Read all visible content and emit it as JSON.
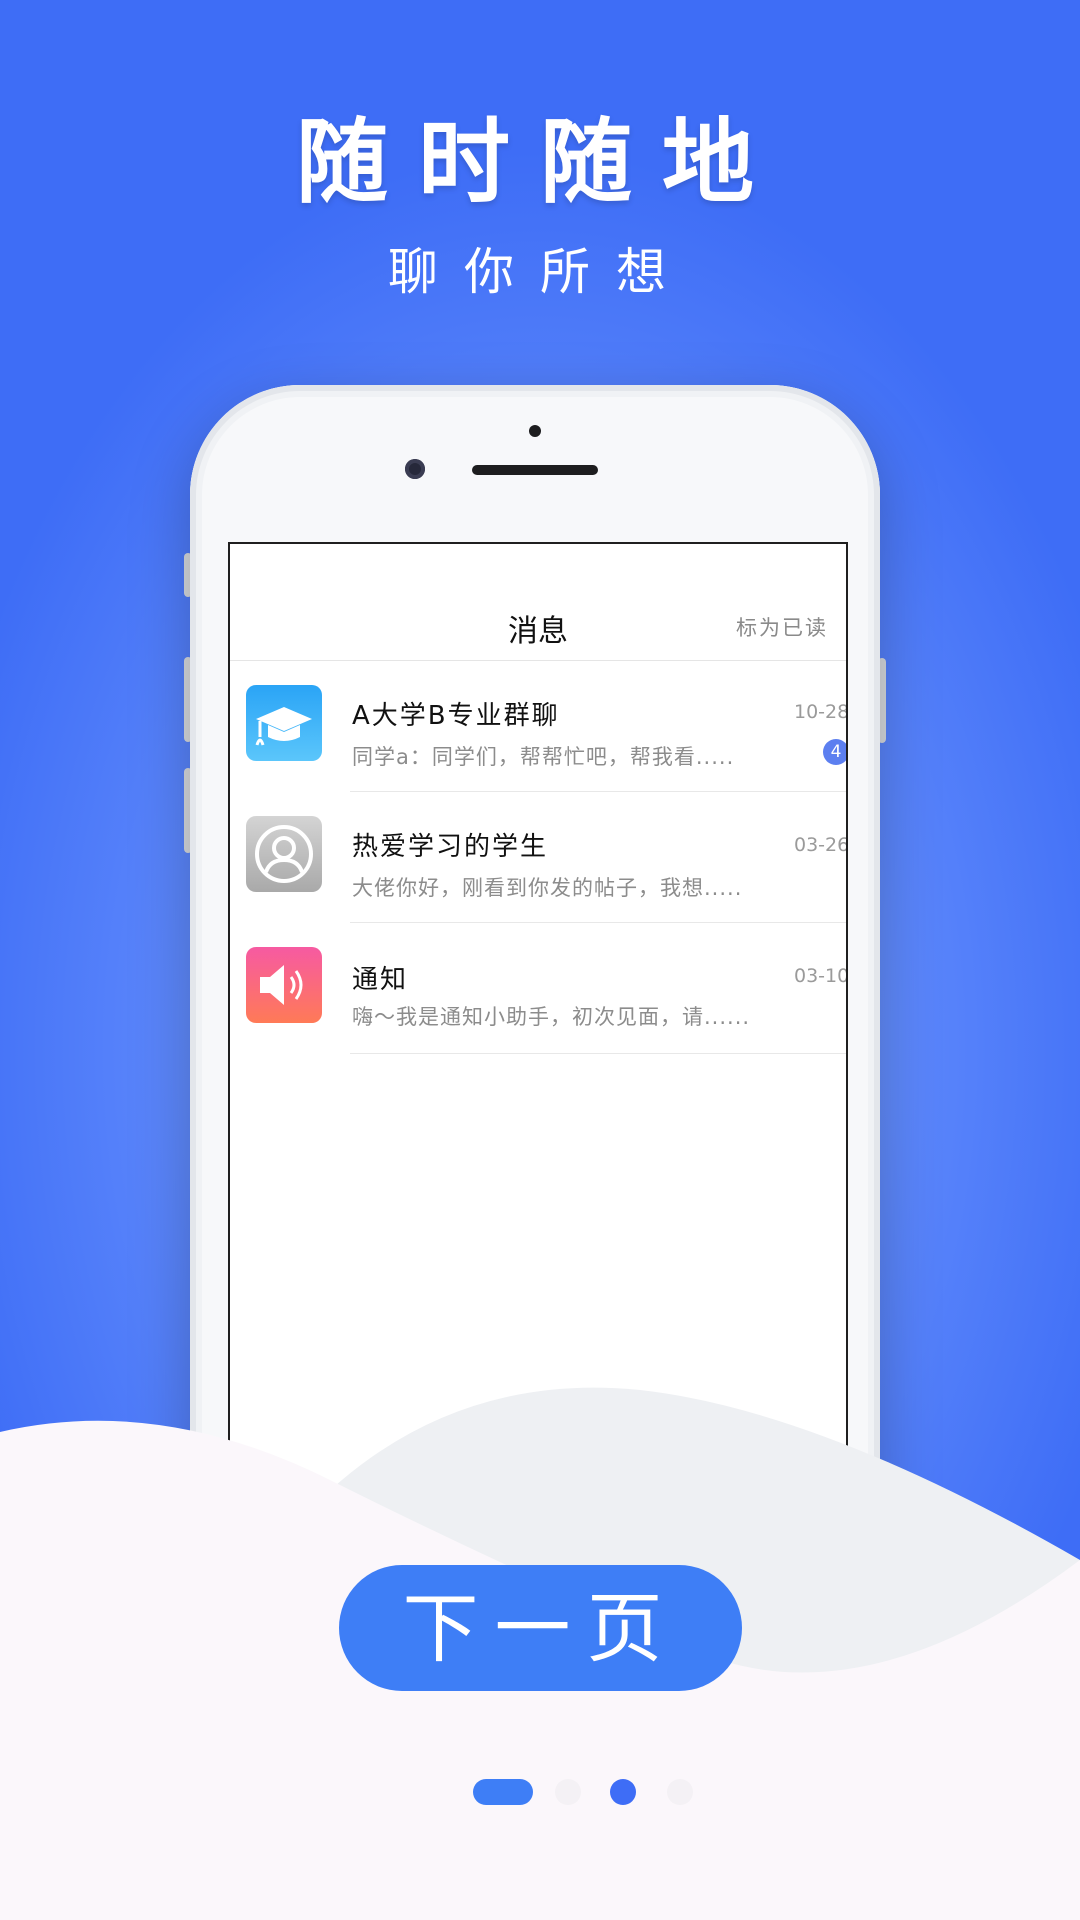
{
  "headline": "随时随地",
  "subline": "聊你所想",
  "app": {
    "title": "消息",
    "mark_read": "标为已读",
    "conversations": [
      {
        "name": "A大学B专业群聊",
        "preview": "同学a：同学们，帮帮忙吧，帮我看.....",
        "date": "10-28",
        "badge": "4",
        "icon": "graduation-cap-icon"
      },
      {
        "name": "热爱学习的学生",
        "preview": "大佬你好，刚看到你发的帖子，我想.....",
        "date": "03-26",
        "icon": "user-silhouette-icon"
      },
      {
        "name": "通知",
        "preview": "嗨～我是通知小助手，初次见面，请......",
        "date": "03-10",
        "icon": "speaker-icon"
      }
    ]
  },
  "next_button": "下一页",
  "pagination": {
    "total": 4,
    "active": 0
  },
  "colors": {
    "accent": "#3e7ef6",
    "background_top": "#3e6df6",
    "badge": "#5c7ff0"
  }
}
